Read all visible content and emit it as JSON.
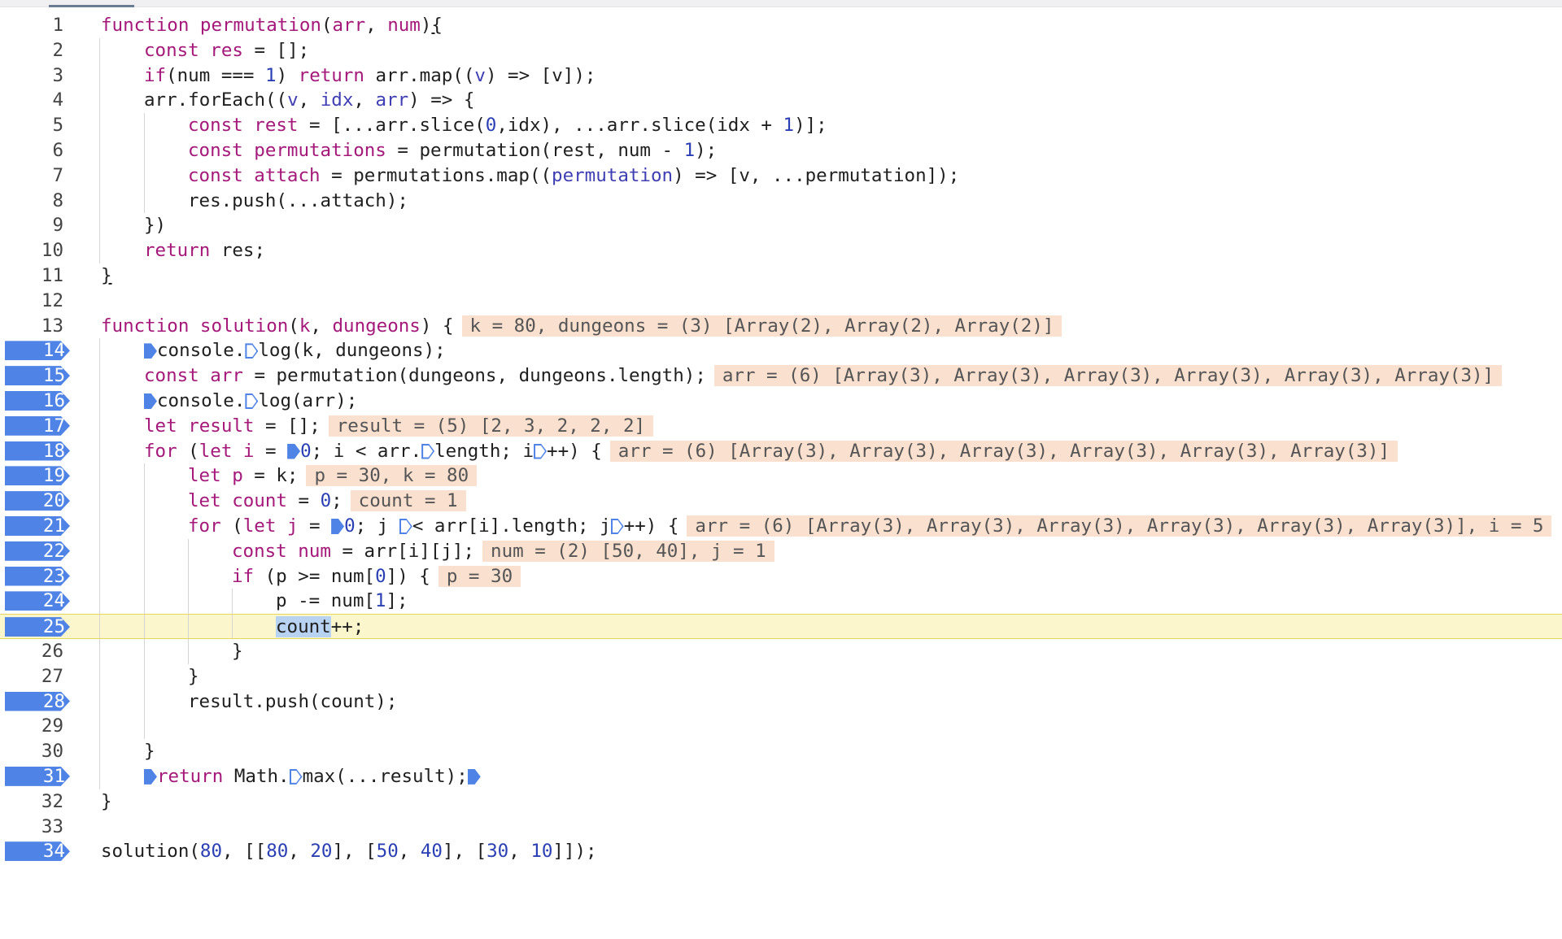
{
  "colors": {
    "breakpoint": "#4f83e6",
    "inline_value_bg": "#fae0cf",
    "current_line_bg": "#fbf6cc",
    "keyword": "#a4197a",
    "number": "#2a3fb3"
  },
  "lines": [
    {
      "n": "1"
    },
    {
      "n": "2"
    },
    {
      "n": "3"
    },
    {
      "n": "4"
    },
    {
      "n": "5"
    },
    {
      "n": "6"
    },
    {
      "n": "7"
    },
    {
      "n": "8"
    },
    {
      "n": "9"
    },
    {
      "n": "10"
    },
    {
      "n": "11"
    },
    {
      "n": "12"
    },
    {
      "n": "13"
    },
    {
      "n": "14"
    },
    {
      "n": "15"
    },
    {
      "n": "16"
    },
    {
      "n": "17"
    },
    {
      "n": "18"
    },
    {
      "n": "19"
    },
    {
      "n": "20"
    },
    {
      "n": "21"
    },
    {
      "n": "22"
    },
    {
      "n": "23"
    },
    {
      "n": "24"
    },
    {
      "n": "25"
    },
    {
      "n": "26"
    },
    {
      "n": "27"
    },
    {
      "n": "28"
    },
    {
      "n": "29"
    },
    {
      "n": "30"
    },
    {
      "n": "31"
    },
    {
      "n": "32"
    },
    {
      "n": "33"
    },
    {
      "n": "34"
    }
  ],
  "breakpoint_lines": [
    "14",
    "15",
    "16",
    "17",
    "18",
    "19",
    "20",
    "21",
    "22",
    "23",
    "24",
    "25",
    "28",
    "31",
    "34"
  ],
  "current_line": "25",
  "code": {
    "l1": [
      "function",
      " ",
      "permutation",
      "(",
      "arr",
      ", ",
      "num",
      ")",
      "{"
    ],
    "l2": [
      "const",
      " ",
      "res",
      " = [];"
    ],
    "l3": [
      "if",
      "(num === ",
      "1",
      ") ",
      "return",
      " arr.map((",
      "v",
      ") => [v]);"
    ],
    "l4": [
      "arr.forEach((",
      "v",
      ", ",
      "idx",
      ", ",
      "arr",
      ") => {"
    ],
    "l5": [
      "const",
      " ",
      "rest",
      " = [...arr.slice(",
      "0",
      ",idx), ...arr.slice(idx + ",
      "1",
      ")];"
    ],
    "l6": [
      "const",
      " ",
      "permutations",
      " = permutation(rest, num - ",
      "1",
      ");"
    ],
    "l7": [
      "const",
      " ",
      "attach",
      " = permutations.map((",
      "permutation",
      ") => [v, ...permutation]);"
    ],
    "l8": [
      "res.push(...attach);"
    ],
    "l9": [
      "})"
    ],
    "l10": [
      "return",
      " res;"
    ],
    "l11": [
      "}"
    ],
    "l13": [
      "function",
      " ",
      "solution",
      "(",
      "k",
      ", ",
      "dungeons",
      ") {"
    ],
    "l13_val": "k = 80, dungeons = (3) [Array(2), Array(2), Array(2)]",
    "l14": [
      "console.",
      "log(k, dungeons);"
    ],
    "l15": [
      "const",
      " ",
      "arr",
      " = permutation(dungeons, dungeons.length);"
    ],
    "l15_val": "arr = (6) [Array(3), Array(3), Array(3), Array(3), Array(3), Array(3)]",
    "l16": [
      "console.",
      "log(arr);"
    ],
    "l17": [
      "let",
      " ",
      "result",
      " = [];"
    ],
    "l17_val": "result = (5) [2, 3, 2, 2, 2]",
    "l18": [
      "for",
      " (",
      "let",
      " ",
      "i",
      " = ",
      "0",
      "; i < arr.",
      "length; i",
      "++) {"
    ],
    "l18_val": "arr = (6) [Array(3), Array(3), Array(3), Array(3), Array(3), Array(3)]",
    "l19": [
      "let",
      " ",
      "p",
      " = k;"
    ],
    "l19_val": "p = 30, k = 80",
    "l20": [
      "let",
      " ",
      "count",
      " = ",
      "0",
      ";"
    ],
    "l20_val": "count = 1",
    "l21": [
      "for",
      " (",
      "let",
      " ",
      "j",
      " = ",
      "0",
      "; j ",
      "< arr[i].length; j",
      "++) {"
    ],
    "l21_val": "arr = (6) [Array(3), Array(3), Array(3), Array(3), Array(3), Array(3)], i = 5",
    "l22": [
      "const",
      " ",
      "num",
      " = arr[i][j];"
    ],
    "l22_val": "num = (2) [50, 40], j = 1",
    "l23": [
      "if",
      " (p >= num[",
      "0",
      "]) {"
    ],
    "l23_val": "p = 30",
    "l24": [
      "p -= num[",
      "1",
      "];"
    ],
    "l25": [
      "count",
      "++;"
    ],
    "l26": [
      "}"
    ],
    "l27": [
      "}"
    ],
    "l28": [
      "result.push(count);"
    ],
    "l30": [
      "}"
    ],
    "l31": [
      "return",
      " Math.",
      "max(...result);"
    ],
    "l32": [
      "}"
    ],
    "l34": [
      "solution(",
      "80",
      ", [[",
      "80",
      ", ",
      "20",
      "], [",
      "50",
      ", ",
      "40",
      "], [",
      "30",
      ", ",
      "10",
      "]]);"
    ]
  }
}
